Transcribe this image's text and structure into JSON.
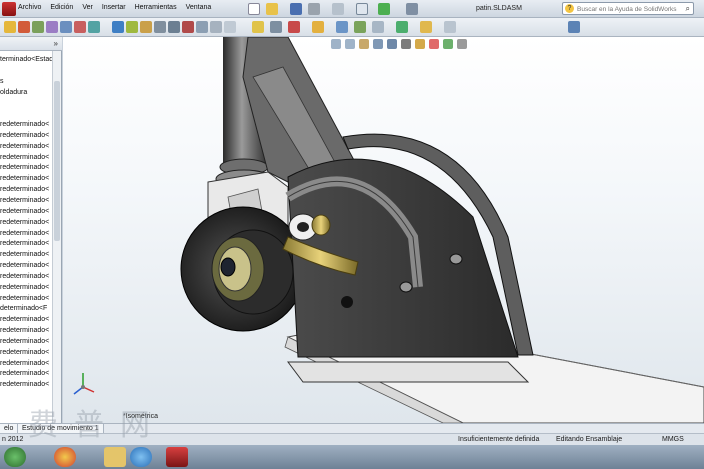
{
  "menu": {
    "items": [
      "Archivo",
      "Edición",
      "Ver",
      "Insertar",
      "Herramientas",
      "Ventana"
    ]
  },
  "window": {
    "file_name": "patin.SLDASM"
  },
  "help_search": {
    "placeholder": "Buscar en la Ayuda de SolidWorks"
  },
  "feature_tree": {
    "items": [
      "terminado<Estado",
      "",
      "s",
      "oldadura",
      "",
      "",
      "redeterminado<",
      "redeterminado<",
      "redeterminado<",
      "redeterminado<",
      "redeterminado<",
      "redeterminado<",
      "redeterminado<",
      "redeterminado<",
      "redeterminado<",
      "redeterminado<",
      "redeterminado<",
      "redeterminado<",
      "redeterminado<",
      "redeterminado<",
      "redeterminado<",
      "redeterminado<",
      "redeterminado<",
      "determinado<F",
      "redeterminado<",
      "redeterminado<",
      "redeterminado<",
      "redeterminado<",
      "redeterminado<",
      "redeterminado<",
      "redeterminado<"
    ]
  },
  "view": {
    "orientation_label": "*Isométrica"
  },
  "tabs": {
    "model": "elo",
    "motion_study": "Estudio de movimiento 1"
  },
  "status": {
    "version": "n 2012",
    "definition": "Insuficientemente definida",
    "mode": "Editando Ensamblaje",
    "units": "MMGS"
  },
  "watermark": "费普网"
}
